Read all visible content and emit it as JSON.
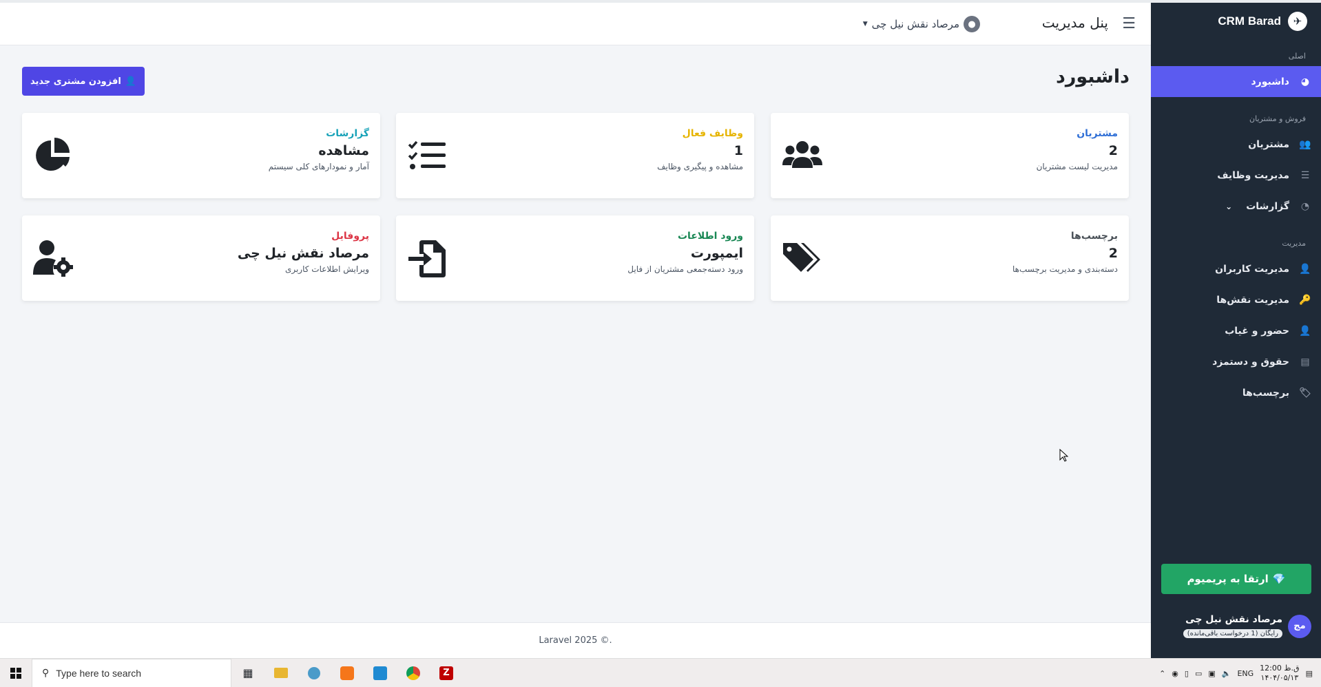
{
  "sidebar": {
    "brand": "CRM Barad",
    "sections": [
      "اصلی",
      "فروش و مشتریان",
      "مدیریت"
    ],
    "items": [
      {
        "label": "داشبورد",
        "icon": "gauge-icon",
        "glyph": "◕"
      },
      {
        "label": "مشتریان",
        "icon": "users-icon",
        "glyph": "👥"
      },
      {
        "label": "مدیریت وظایف",
        "icon": "tasks-icon",
        "glyph": "☰"
      },
      {
        "label": "گزارشات",
        "icon": "pie-chart-icon",
        "glyph": "◔"
      },
      {
        "label": "مدیریت کاربران",
        "icon": "user-cog-icon",
        "glyph": "👤"
      },
      {
        "label": "مدیریت نقش‌ها",
        "icon": "key-icon",
        "glyph": "🔑"
      },
      {
        "label": "حضور و غیاب",
        "icon": "user-clock-icon",
        "glyph": "👤"
      },
      {
        "label": "حقوق و دستمزد",
        "icon": "receipt-icon",
        "glyph": "▤"
      },
      {
        "label": "برچسب‌ها",
        "icon": "tag-icon",
        "glyph": "🏷"
      }
    ],
    "premium_label": "ارتقا به پریمیوم",
    "user": {
      "avatar": "مج",
      "name": "مرصاد نقش نیل چی",
      "badge": "رایگان (1 درخواست باقی‌مانده)"
    }
  },
  "header": {
    "title": "پنل مدیریت",
    "user_name": "مرصاد نقش نیل چی"
  },
  "main": {
    "page_title": "داشبورد",
    "add_button": "افزودن مشتری جدید",
    "cards": [
      {
        "label": "مشتریان",
        "value": "2",
        "desc": "مدیریت لیست مشتریان",
        "color": "#2f6fd6",
        "icon": "users-icon"
      },
      {
        "label": "وظایف فعال",
        "value": "1",
        "desc": "مشاهده و پیگیری وظایف",
        "color": "#e6b400",
        "icon": "task-list-icon"
      },
      {
        "label": "گزارشات",
        "value": "مشاهده",
        "desc": "آمار و نمودارهای کلی سیستم",
        "color": "#17a2b8",
        "icon": "pie-chart-icon"
      },
      {
        "label": "برچسب‌ها",
        "value": "2",
        "desc": "دسته‌بندی و مدیریت برچسب‌ها",
        "color": "#495057",
        "icon": "tags-icon"
      },
      {
        "label": "ورود اطلاعات",
        "value": "ایمپورت",
        "desc": "ورود دسته‌جمعی مشتریان از فایل",
        "color": "#198754",
        "icon": "file-import-icon"
      },
      {
        "label": "پروفایل",
        "value": "مرصاد نقش نیل چی",
        "desc": "ویرایش اطلاعات کاربری",
        "color": "#dc3545",
        "icon": "user-cog-icon"
      }
    ]
  },
  "footer": {
    "text": "Laravel 2025 ©."
  },
  "taskbar": {
    "search_placeholder": "Type here to search",
    "lang": "ENG",
    "time": "12:00 ق.ظ",
    "date": "۱۴۰۴/۰۵/۱۳"
  }
}
